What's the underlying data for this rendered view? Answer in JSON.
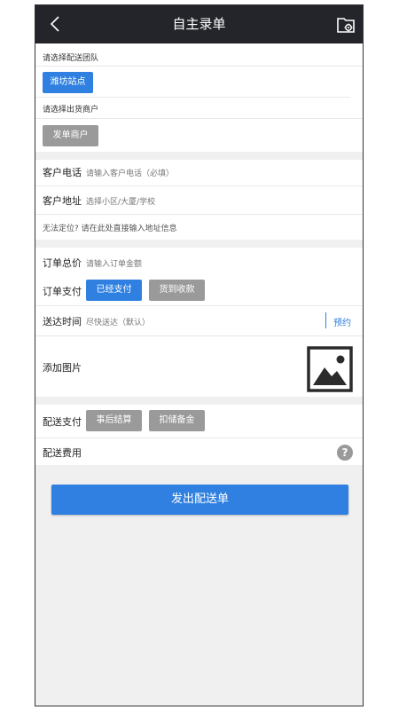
{
  "header": {
    "title": "自主录单",
    "back_icon": "chevron-left-icon",
    "right_icon": "folder-gear-icon"
  },
  "team": {
    "label": "请选择配送团队",
    "selected": "潍坊站点"
  },
  "merchant": {
    "label": "请选择出货商户",
    "selected": "发单商户"
  },
  "customer": {
    "phone_label": "客户电话",
    "phone_placeholder": "请输入客户电话（必填）",
    "address_label": "客户地址",
    "address_placeholder": "选择小区/大厦/学校",
    "manual_hint": "无法定位? 请在此处直接输入地址信息"
  },
  "order": {
    "total_label": "订单总价",
    "total_placeholder": "请输入订单金额",
    "payment_label": "订单支付",
    "paid_option": "已经支付",
    "cod_option": "货到收款",
    "time_label": "送达时间",
    "time_value": "尽快送达（默认）",
    "reserve": "预约",
    "image_label": "添加图片",
    "image_icon": "image-placeholder-icon"
  },
  "delivery": {
    "payment_label": "配送支付",
    "settle_option": "事后结算",
    "deposit_option": "扣储备金",
    "fee_label": "配送费用",
    "help_icon": "question-mark-icon"
  },
  "submit_label": "发出配送单",
  "colors": {
    "header": "#24252a",
    "accent": "#2f80e0",
    "inactive_button": "#9a9a9a",
    "background": "#f0f0f0"
  }
}
